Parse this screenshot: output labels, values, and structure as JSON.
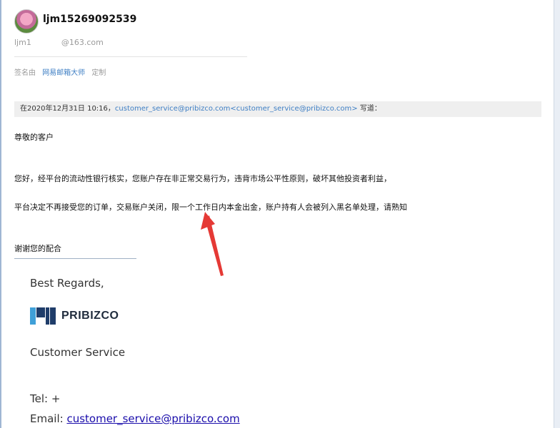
{
  "header": {
    "username": "ljm15269092539",
    "email_prefix": "ljm1",
    "email_suffix": "@163.com"
  },
  "signature": {
    "label": "签名由",
    "tool": "网易邮箱大师",
    "custom": "定制"
  },
  "quote": {
    "prefix": "在2020年12月31日 10:16，",
    "sender": "customer_service@pribizco.com<customer_service@pribizco.com>",
    "suffix": " 写道："
  },
  "body": {
    "greeting": "尊敬的客户",
    "line1": "您好，经平台的流动性银行核实，您账户存在非正常交易行为，违背市场公平性原则，破坏其他投资者利益，",
    "line2": "平台决定不再接受您的订单，交易账户关闭，限一个工作日内本金出金，账户持有人会被列入黑名单处理，请熟知",
    "thanks": "谢谢您的配合"
  },
  "footer": {
    "regards": "Best Regards,",
    "brand": "PRIBIZCO",
    "service": "Customer Service",
    "tel_label": "Tel: +",
    "email_label": "Email: ",
    "email_link": "customer_service@pribizco.com"
  },
  "colors": {
    "link": "#3f7fc4",
    "arrow": "#e53935",
    "brand_blue": "#3fa0d8",
    "brand_navy": "#1f3d6a"
  }
}
